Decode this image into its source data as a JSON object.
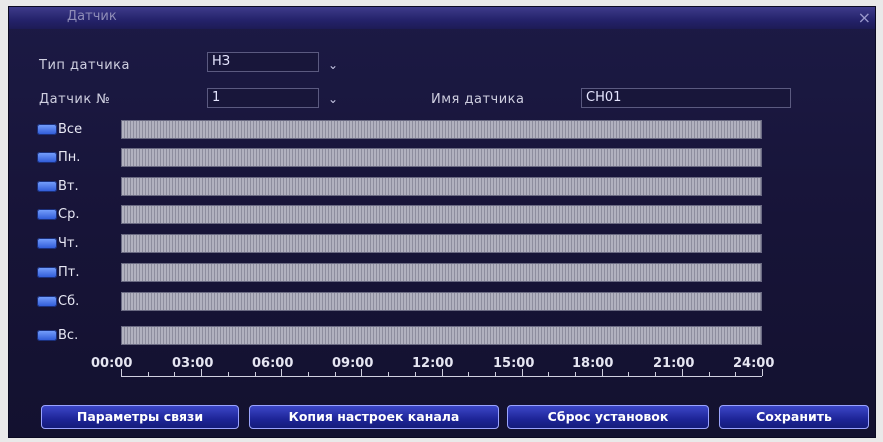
{
  "window": {
    "title": "Датчик",
    "close_glyph": "×"
  },
  "form": {
    "sensor_type_label": "Тип датчика",
    "sensor_type_value": "НЗ",
    "sensor_no_label": "Датчик №",
    "sensor_no_value": "1",
    "sensor_name_label": "Имя датчика",
    "sensor_name_value": "CH01"
  },
  "schedule": {
    "rows": [
      {
        "label": "Все"
      },
      {
        "label": "Пн."
      },
      {
        "label": "Вт."
      },
      {
        "label": "Ср."
      },
      {
        "label": "Чт."
      },
      {
        "label": "Пт."
      },
      {
        "label": "Сб."
      },
      {
        "label": "Вс."
      }
    ],
    "axis": [
      "00:00",
      "03:00",
      "06:00",
      "09:00",
      "12:00",
      "15:00",
      "18:00",
      "21:00",
      "24:00"
    ]
  },
  "buttons": {
    "link_params": "Параметры связи",
    "copy_channel": "Копия настроек канала",
    "reset": "Сброс установок",
    "save": "Сохранить"
  },
  "colors": {
    "window_bg": "#1a1840",
    "accent": "#2b56d4",
    "bar": "#a8a8b8"
  }
}
